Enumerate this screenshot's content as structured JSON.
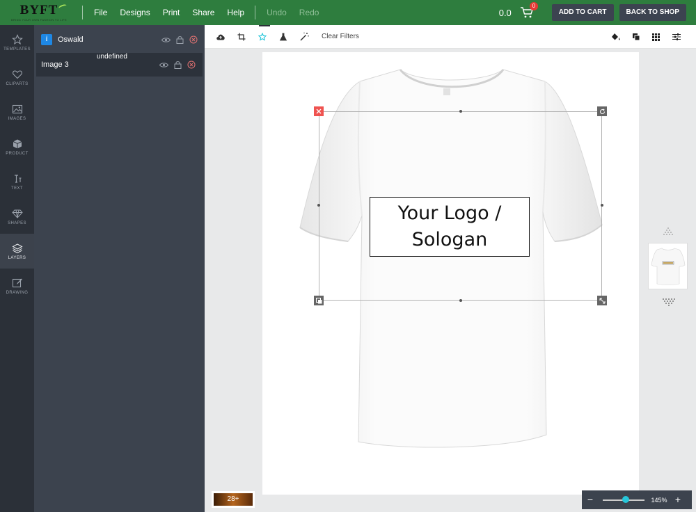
{
  "app": {
    "logo_text": "BYFT",
    "logo_tagline": "BRING YOUR OWN FASHION TO LIFE"
  },
  "menu": {
    "items": [
      {
        "label": "File",
        "enabled": true
      },
      {
        "label": "Designs",
        "enabled": true
      },
      {
        "label": "Print",
        "enabled": true
      },
      {
        "label": "Share",
        "enabled": true
      },
      {
        "label": "Help",
        "enabled": true
      }
    ],
    "history": [
      {
        "label": "Undo",
        "enabled": false
      },
      {
        "label": "Redo",
        "enabled": false
      }
    ]
  },
  "header": {
    "price": "0.0",
    "cart_count": "0",
    "add_to_cart_label": "ADD TO CART",
    "back_to_shop_label": "BACK TO SHOP"
  },
  "rail": {
    "items": [
      {
        "label": "TEMPLATES",
        "icon": "star-icon",
        "active": false
      },
      {
        "label": "CLIPARTS",
        "icon": "heart-icon",
        "active": false
      },
      {
        "label": "IMAGES",
        "icon": "image-icon",
        "active": false
      },
      {
        "label": "PRODUCT",
        "icon": "cube-icon",
        "active": false
      },
      {
        "label": "TEXT",
        "icon": "text-icon",
        "active": false
      },
      {
        "label": "SHAPES",
        "icon": "diamond-icon",
        "active": false
      },
      {
        "label": "LAYERS",
        "icon": "layers-icon",
        "active": true
      },
      {
        "label": "DRAWING",
        "icon": "pencil-icon",
        "active": false
      }
    ]
  },
  "layers": {
    "items": [
      {
        "name": "Oswald",
        "type": "text"
      },
      {
        "name": "Image 3",
        "type": "image"
      }
    ],
    "tooltip": "undefined"
  },
  "toolbar": {
    "clear_filters_label": "Clear Filters"
  },
  "canvas": {
    "design_text": "Your Logo / Sologan"
  },
  "bottom": {
    "swatch_label": "28+",
    "zoom_label": "145%",
    "zoom_level": 0.55,
    "zoom_minus": "−",
    "zoom_plus": "+"
  },
  "colors": {
    "topbar": "#2e7d3e",
    "rail": "#2b3038",
    "panel": "#3c434e",
    "accent": "#26c6da",
    "delete": "#ef5350"
  }
}
